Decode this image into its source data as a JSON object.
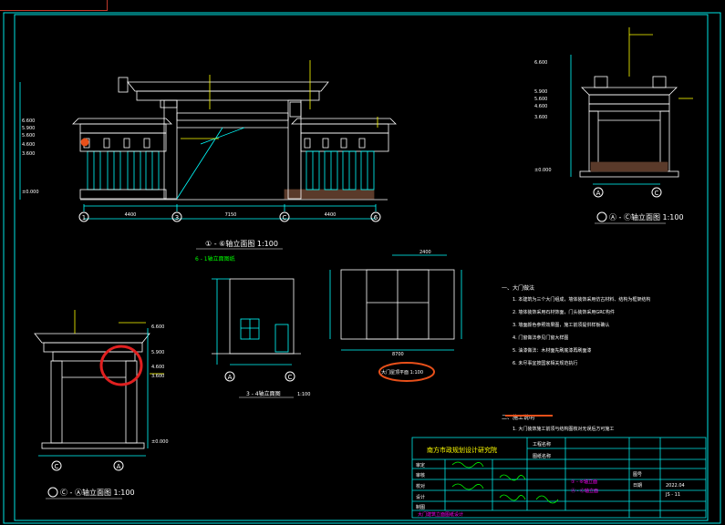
{
  "colors": {
    "background": "#000000",
    "frame": "#00e5e5",
    "line": "#ffffff",
    "cyan": "#00ffff",
    "yellow": "#ffff00",
    "green": "#00ff00",
    "magenta": "#ff00ff",
    "red_markup": "#e02020",
    "orange_markup": "#e8501a",
    "brown_ground": "#5a3a2a"
  },
  "front_elevation": {
    "title": "① - ⑥轴立面图 1:100",
    "axis_labels": [
      "1",
      "3",
      "C",
      "6"
    ],
    "level_left": [
      "6.600",
      "5.900",
      "5.600",
      "4.600",
      "3.600",
      "±0.000"
    ],
    "dims_bottom": [
      "4400",
      "7150",
      "4400"
    ]
  },
  "side_elevation_top_right": {
    "title": "Ⓐ - Ⓒ轴立面图 1:100",
    "axis_labels": [
      "A",
      "C"
    ],
    "levels": [
      "6.600",
      "5.900",
      "5.600",
      "4.600",
      "3.600",
      "±0.000"
    ]
  },
  "side_elevation_bottom_left": {
    "title": "Ⓒ - Ⓐ轴立面图 1:100",
    "axis_labels": [
      "C",
      "A"
    ],
    "levels": [
      "6.600",
      "5.900",
      "4.600",
      "3.600",
      "±0.000"
    ]
  },
  "section_3_4": {
    "title": "3 - 4轴立面图",
    "axis_labels": [
      "A",
      "C"
    ],
    "scale": "1:100"
  },
  "plan": {
    "label": "大门屋顶平面 1:100",
    "dim_top": "2400",
    "dim_bottom": "8700"
  },
  "heading_green": "6 - 1轴立面图纸",
  "notes": {
    "section1_title": "一、大门做法",
    "section1_items": [
      "1. 本建筑为三个大门组成，墙体装饰采用仿古材料、结构为框架结构",
      "2. 墙体装饰采用石材饰面，门头装饰采用GRC构件",
      "3. 墙面颜色参照效果图，施工前须提供样板确认",
      "4. 门窗做法参见门窗大样图",
      "5. 油漆做法：木材面先刷底漆再刷面漆",
      "6. 未尽事宜按国家相关规范执行"
    ],
    "section2_title": "二、施工说明",
    "section2_items": [
      "1. 大门装饰施工前须与结构图核对无误后方可施工"
    ]
  },
  "title_block": {
    "institute": "南方市政规划设计研究院",
    "row_labels": [
      "审定",
      "审核",
      "校对",
      "设计",
      "制图"
    ],
    "project_label": "工程名称",
    "drawing_label": "图纸名称",
    "drawing_name_1": "① - ⑥轴立面",
    "drawing_name_2": "Ⓐ - Ⓒ轴立面",
    "drawing_no_label": "图号",
    "drawing_no": "JS - 11",
    "date_label": "日期",
    "date": "2022.04",
    "bottom_caption": "大门建筑立面图纸设计"
  }
}
